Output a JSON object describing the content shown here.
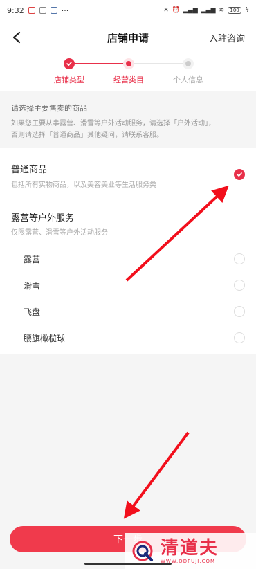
{
  "status_bar": {
    "time": "9:32",
    "dots": "···",
    "battery": "100"
  },
  "nav": {
    "title": "店铺申请",
    "action": "入驻咨询"
  },
  "steps": [
    {
      "label": "店铺类型",
      "state": "done"
    },
    {
      "label": "经营类目",
      "state": "active"
    },
    {
      "label": "个人信息",
      "state": "todo"
    }
  ],
  "hint": {
    "title": "请选择主要售卖的商品",
    "line1": "如果您主要从事露营、滑雪等户外活动服务，请选择「户外活动」，",
    "line2": "否则请选择「普通商品」其他疑问，请联系客服。"
  },
  "options": {
    "general": {
      "title": "普通商品",
      "desc": "包括所有实物商品，以及美容美业等生活服务类",
      "checked": true
    },
    "outdoor": {
      "title": "露营等户外服务",
      "desc": "仅限露营、滑雪等户外活动服务",
      "items": [
        "露营",
        "滑雪",
        "飞盘",
        "腰旗橄榄球"
      ]
    }
  },
  "submit": {
    "label": "下一步"
  },
  "watermark": {
    "text": "清道夫",
    "url": "WWW.QDFUJI.COM"
  },
  "colors": {
    "accent": "#e8304a",
    "button": "#f03a4c"
  }
}
